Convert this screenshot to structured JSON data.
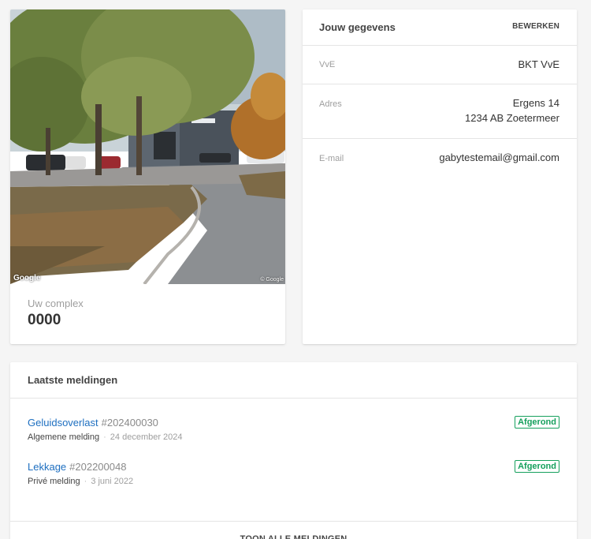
{
  "complex": {
    "photo_watermark": "Google",
    "photo_copyright": "© Google",
    "label": "Uw complex",
    "value": "0000"
  },
  "details": {
    "title": "Jouw gegevens",
    "edit_label": "BEWERKEN",
    "rows": [
      {
        "label": "VvE",
        "value": "BKT VvE"
      },
      {
        "label": "Adres",
        "value_line1": "Ergens 14",
        "value_line2": "1234 AB Zoetermeer"
      },
      {
        "label": "E-mail",
        "value": "gabytestemail@gmail.com"
      }
    ]
  },
  "meldingen": {
    "title": "Laatste meldingen",
    "items": [
      {
        "title": "Geluidsoverlast",
        "number": "#202400030",
        "type": "Algemene melding",
        "date": "24 december 2024",
        "status": "Afgerond"
      },
      {
        "title": "Lekkage",
        "number": "#202200048",
        "type": "Privé melding",
        "date": "3 juni 2022",
        "status": "Afgerond"
      }
    ],
    "show_all_label": "TOON ALLE MELDINGEN"
  },
  "colors": {
    "link": "#1e6fc0",
    "status_done": "#16a05d",
    "background": "#f5f5f5"
  }
}
